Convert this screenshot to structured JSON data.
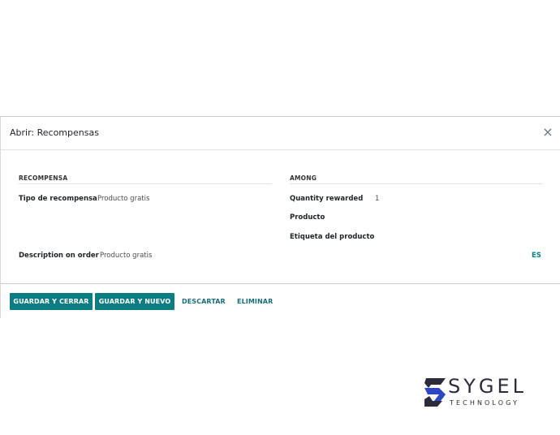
{
  "dialog": {
    "title": "Abrir: Recompensas",
    "close_glyph": "×"
  },
  "reward": {
    "section_title": "RECOMPENSA",
    "reward_type_label": "Tipo de recompensa",
    "reward_type_value": "Producto gratis",
    "description_label": "Description on order",
    "description_value": "Producto gratis",
    "lang_label": "ES"
  },
  "among": {
    "section_title": "AMONG",
    "quantity_label": "Quantity rewarded",
    "quantity_value": "1",
    "product_label": "Producto",
    "product_tag_label": "Etiqueta del producto"
  },
  "footer": {
    "save_close_label": "GUARDAR Y CERRAR",
    "save_new_label": "GUARDAR Y NUEVO",
    "discard_label": "DESCARTAR",
    "delete_label": "ELIMINAR"
  },
  "logo": {
    "word": "SYGEL",
    "sub": "TECHNOLOGY",
    "colors": {
      "dark": "#2b2b3c",
      "blue": "#2f46c3"
    }
  },
  "colors": {
    "primary": "#0e7d82",
    "link": "#1b6d77",
    "lang": "#017e84"
  }
}
